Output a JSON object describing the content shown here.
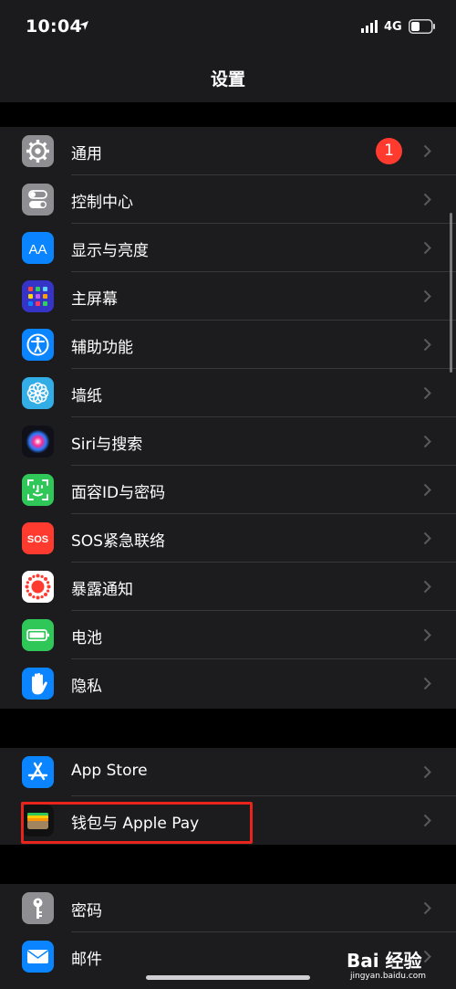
{
  "status_bar": {
    "time": "10:04",
    "network": "4G"
  },
  "header": {
    "title": "设置"
  },
  "groups": [
    {
      "items": [
        {
          "label": "通用",
          "badge": "1"
        },
        {
          "label": "控制中心"
        },
        {
          "label": "显示与亮度"
        },
        {
          "label": "主屏幕"
        },
        {
          "label": "辅助功能"
        },
        {
          "label": "墙纸"
        },
        {
          "label": "Siri与搜索"
        },
        {
          "label": "面容ID与密码"
        },
        {
          "label": "SOS紧急联络"
        },
        {
          "label": "暴露通知"
        },
        {
          "label": "电池"
        },
        {
          "label": "隐私"
        }
      ]
    },
    {
      "items": [
        {
          "label": "App Store"
        },
        {
          "label": "钱包与 Apple Pay"
        }
      ]
    },
    {
      "items": [
        {
          "label": "密码"
        },
        {
          "label": "邮件"
        }
      ]
    }
  ],
  "icons": {
    "general": "gear-icon",
    "control_center": "toggle-icon",
    "display": "text-size-icon",
    "home_screen": "app-grid-icon",
    "accessibility": "accessibility-icon",
    "wallpaper": "flower-icon",
    "siri": "siri-icon",
    "face_id": "face-id-icon",
    "sos": "sos-icon",
    "exposure": "exposure-icon",
    "battery": "battery-icon",
    "privacy": "hand-icon",
    "app_store": "app-store-icon",
    "wallet": "wallet-icon",
    "passwords": "key-icon",
    "mail": "envelope-icon"
  },
  "icon_texts": {
    "text_size": "AA",
    "sos": "SOS"
  },
  "colors": {
    "background": "#000000",
    "group_background": "#1c1c1e",
    "badge": "#ff3b30",
    "highlight": "#e8241c"
  },
  "watermark": {
    "text": "Bai 经验",
    "subtext": "jingyan.baidu.com"
  }
}
